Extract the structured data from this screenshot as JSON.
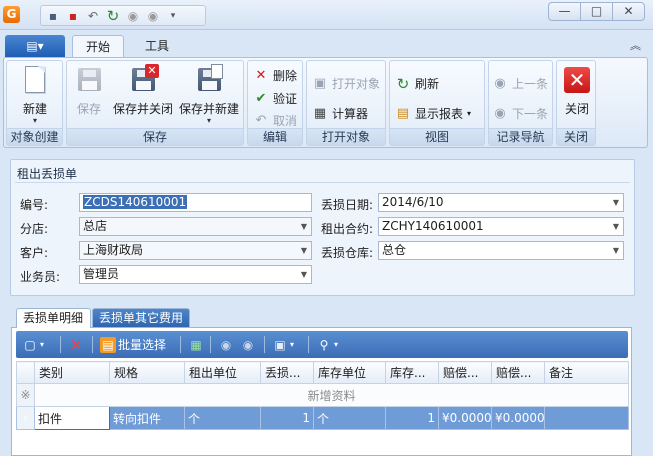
{
  "app": {
    "logo_glyph": "G"
  },
  "window_buttons": {
    "minimize": "—",
    "maximize": "□",
    "close": "✕"
  },
  "ribbon_tabs": {
    "file_glyph": "▤▾",
    "start": "开始",
    "tools": "工具"
  },
  "ribbon": {
    "groups": {
      "create": "对象创建",
      "save": "保存",
      "edit": "编辑",
      "open": "打开对象",
      "view": "视图",
      "nav": "记录导航",
      "close": "关闭"
    },
    "new": "新建",
    "save": "保存",
    "save_close": "保存并关闭",
    "save_new": "保存并新建",
    "delete": "删除",
    "validate": "验证",
    "cancel": "取消",
    "open_object": "打开对象",
    "calculator": "计算器",
    "refresh": "刷新",
    "show_report": "显示报表",
    "prev": "上一条",
    "next": "下一条",
    "close": "关闭"
  },
  "form": {
    "title": "租出丢损单",
    "labels": {
      "code": "编号:",
      "branch": "分店:",
      "customer": "客户:",
      "salesman": "业务员:",
      "loss_date": "丢损日期:",
      "contract": "租出合约:",
      "warehouse": "丢损仓库:"
    },
    "values": {
      "code": "ZCDS140610001",
      "branch": "总店",
      "customer": "上海财政局",
      "salesman": "管理员",
      "loss_date": "2014/6/10",
      "contract": "ZCHY140610001",
      "warehouse": "总仓"
    }
  },
  "detail_tabs": {
    "detail": "丢损单明细",
    "other_fees": "丢损单其它费用"
  },
  "detail_toolbar": {
    "batch_select": "批量选择"
  },
  "grid": {
    "columns": [
      "类别",
      "规格",
      "租出单位",
      "丢损...",
      "库存单位",
      "库存...",
      "赔偿...",
      "赔偿...",
      "备注"
    ],
    "new_row_indicator": "※",
    "new_row_text": "新增资料",
    "rows": [
      {
        "indicator": "›",
        "cells": [
          "扣件",
          "转向扣件",
          "个",
          "1",
          "个",
          "1",
          "¥0.0000",
          "¥0.0000",
          ""
        ]
      }
    ]
  }
}
